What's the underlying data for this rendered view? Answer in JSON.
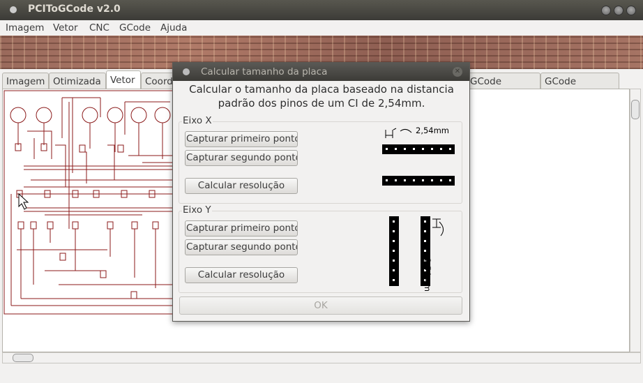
{
  "window": {
    "title": "PCIToGCode  v2.0"
  },
  "menu": [
    "Imagem",
    "Vetor",
    "CNC",
    "GCode",
    "Ajuda"
  ],
  "tabs": [
    "Imagem",
    "Otimizada",
    "Vetor",
    "Coord",
    "GCode Furação",
    "GCode Recorte"
  ],
  "active_tab": "Vetor",
  "dialog": {
    "title": "Calcular tamanho da placa",
    "heading_line1": "Calcular o tamanho da placa baseado na distancia",
    "heading_line2": "padrão dos pinos de um CI de 2,54mm.",
    "axis_x": {
      "label": "Eixo X",
      "capture_first": "Capturar primeiro ponto",
      "capture_second": "Capturar segundo ponto",
      "calculate": "Calcular resolução",
      "dimension": "2,54mm"
    },
    "axis_y": {
      "label": "Eixo Y",
      "capture_first": "Capturar primeiro ponto",
      "capture_second": "Capturar segundo ponto",
      "calculate": "Calcular resolução",
      "dimension": "2,54mm"
    },
    "ok": "OK"
  },
  "colors": {
    "trace": "#8b1a1a",
    "titlebar": "#3c3b37"
  }
}
